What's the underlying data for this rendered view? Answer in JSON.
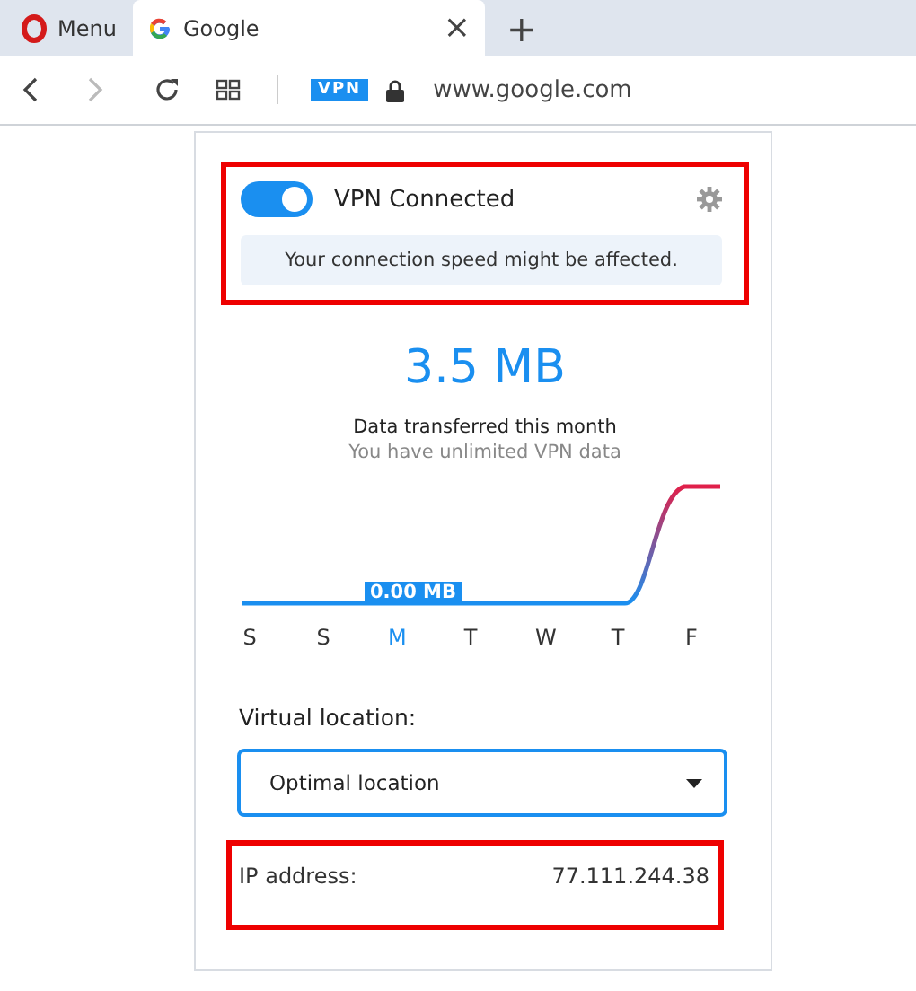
{
  "tabs": [
    {
      "kind": "menu",
      "label": "Menu",
      "selected": false
    },
    {
      "kind": "page",
      "label": "Google",
      "selected": true,
      "close": "×"
    }
  ],
  "new_tab": "+",
  "address_bar": {
    "vpn_badge": "VPN",
    "url": "www.google.com"
  },
  "vpn_popup": {
    "status": {
      "highlighted": true,
      "on": true,
      "label": "VPN Connected",
      "notice": "Your connection speed might be affected."
    },
    "data_total": "3.5 MB",
    "data_caption": "Data transferred this month",
    "data_note": "You have unlimited VPN data",
    "graph_label": "0.00 MB",
    "days": [
      {
        "label": "S",
        "selected": false
      },
      {
        "label": "S",
        "selected": false
      },
      {
        "label": "M",
        "selected": true
      },
      {
        "label": "T",
        "selected": false
      },
      {
        "label": "W",
        "selected": false
      },
      {
        "label": "T",
        "selected": false
      },
      {
        "label": "F",
        "selected": false
      }
    ],
    "location_label": "Virtual location:",
    "location_value": "Optimal location",
    "ip": {
      "highlighted": true,
      "label": "IP address:",
      "value": "77.111.244.38"
    }
  }
}
